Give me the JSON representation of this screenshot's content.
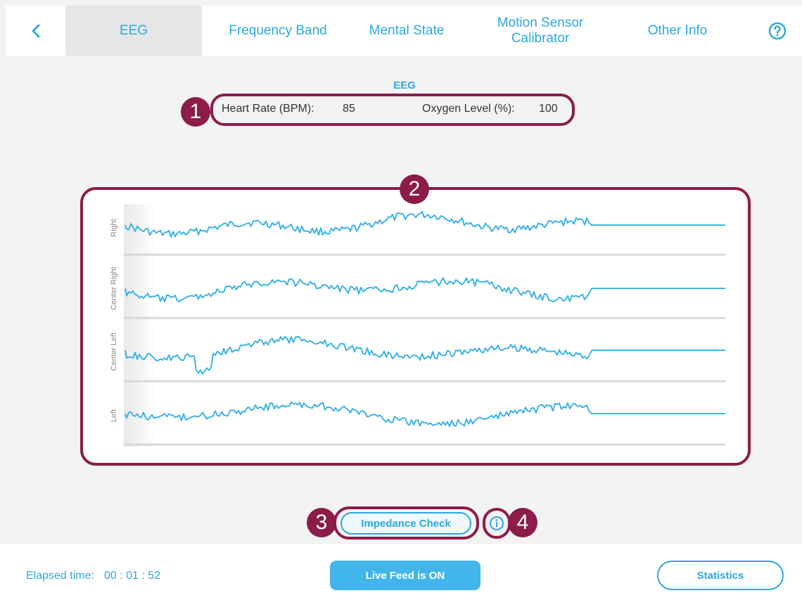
{
  "nav": {
    "tabs": [
      {
        "label": "EEG",
        "active": true
      },
      {
        "label": "Frequency Band",
        "active": false
      },
      {
        "label": "Mental State",
        "active": false
      },
      {
        "label": "Motion Sensor Calibrator",
        "active": false
      },
      {
        "label": "Other Info",
        "active": false
      }
    ],
    "back_icon": "chevron-left-icon",
    "help_icon": "question-circle-icon"
  },
  "main": {
    "section_title": "EEG",
    "heart_rate_label": "Heart Rate (BPM):",
    "heart_rate_value": "85",
    "oxygen_label": "Oxygen Level (%):",
    "oxygen_value": "100"
  },
  "chart_data": {
    "type": "line",
    "title": "",
    "series": [
      {
        "name": "Right"
      },
      {
        "name": "Center Right"
      },
      {
        "name": "Center Left"
      },
      {
        "name": "Left"
      }
    ],
    "grid": false,
    "note_shape": "noisy waveform that becomes flat at the right end"
  },
  "markers": [
    "1",
    "2",
    "3",
    "4"
  ],
  "actions": {
    "impedance_label": "Impedance Check",
    "info_icon": "info-circle-icon"
  },
  "footer": {
    "elapsed_label": "Elapsed time:",
    "elapsed_value": "00 : 01 : 52",
    "live_label": "Live Feed is ON",
    "stats_label": "Statistics"
  },
  "colors": {
    "accent": "#2ea8df",
    "highlight": "#8c1c4a",
    "signal": "#3fb3e8"
  }
}
